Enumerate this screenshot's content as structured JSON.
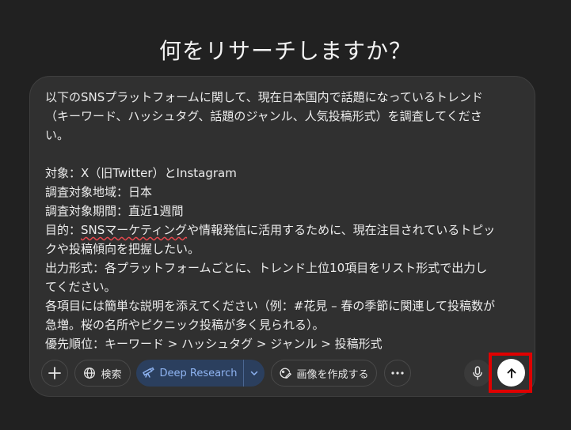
{
  "heading": "何をリサーチしますか？",
  "prompt": {
    "lines": [
      "以下のSNSプラットフォームに関して、現在日本国内で話題になっているトレンド",
      "（キーワード、ハッシュタグ、話題のジャンル、人気投稿形式）を調査してくださ",
      "い。",
      "",
      "対象：X（旧Twitter）とInstagram",
      "調査対象地域：日本",
      "調査対象期間：直近1週間",
      "目的：SNSマーケティングや情報発信に活用するために、現在注目されているトピッ",
      "クや投稿傾向を把握したい。",
      "出力形式：各プラットフォームごとに、トレンド上位10項目をリスト形式で出力し",
      "てください。",
      "各項目には簡単な説明を添えてください（例：#花見 – 春の季節に関連して投稿数が",
      "急増。桜の名所やピクニック投稿が多く見られる）。",
      "優先順位：キーワード > ハッシュタグ > ジャンル > 投稿形式"
    ],
    "line8_prefix": "目的：",
    "line8_flagged": "SNSマーケティング",
    "line8_rest": "や情報発信に活用するために、現在注目されているトピッ"
  },
  "toolbar": {
    "add_icon": "plus-icon",
    "search_label": "検索",
    "search_icon": "globe-icon",
    "deep_research_label": "Deep Research",
    "deep_research_icon": "telescope-icon",
    "deep_research_color": "#8fb4f2",
    "create_image_label": "画像を作成する",
    "create_image_icon": "image-create-icon",
    "more_icon": "ellipsis-icon",
    "mic_icon": "microphone-icon",
    "send_icon": "arrow-up-icon",
    "highlight_color": "#e00000"
  }
}
